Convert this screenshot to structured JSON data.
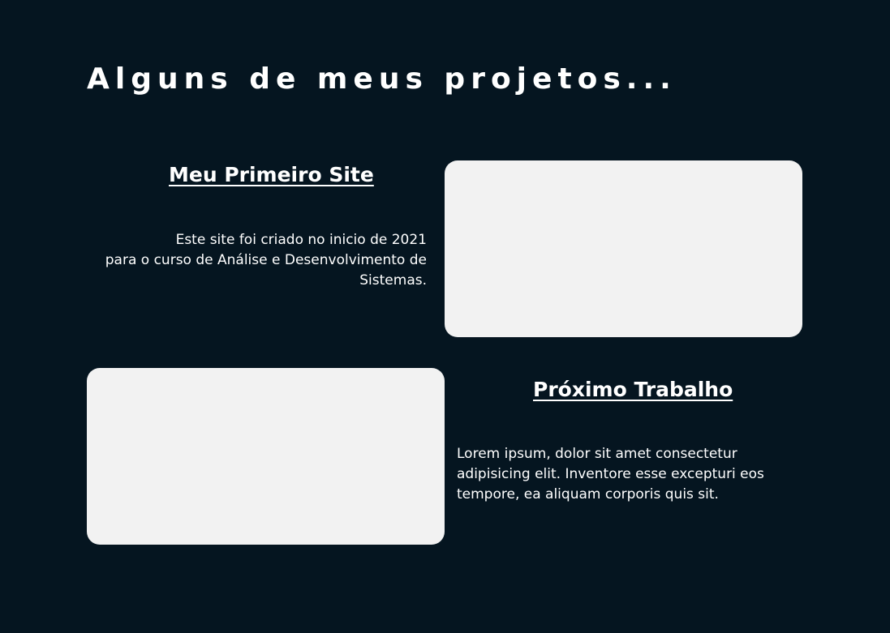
{
  "section": {
    "title": "Alguns de meus projetos..."
  },
  "projects": [
    {
      "title": "Meu Primeiro Site",
      "description_lines": [
        "Este site foi criado no inicio de 2021",
        "para o curso de Análise e Desenvolvimento de",
        "Sistemas."
      ]
    },
    {
      "title": "Próximo Trabalho",
      "description_lines": [
        "Lorem ipsum, dolor sit amet consectetur",
        "adipisicing elit. Inventore esse excepturi eos",
        "tempore, ea aliquam corporis quis sit."
      ]
    }
  ],
  "colors": {
    "background": "#051520",
    "text": "#ffffff",
    "preview_fill": "#f2f2f2"
  }
}
